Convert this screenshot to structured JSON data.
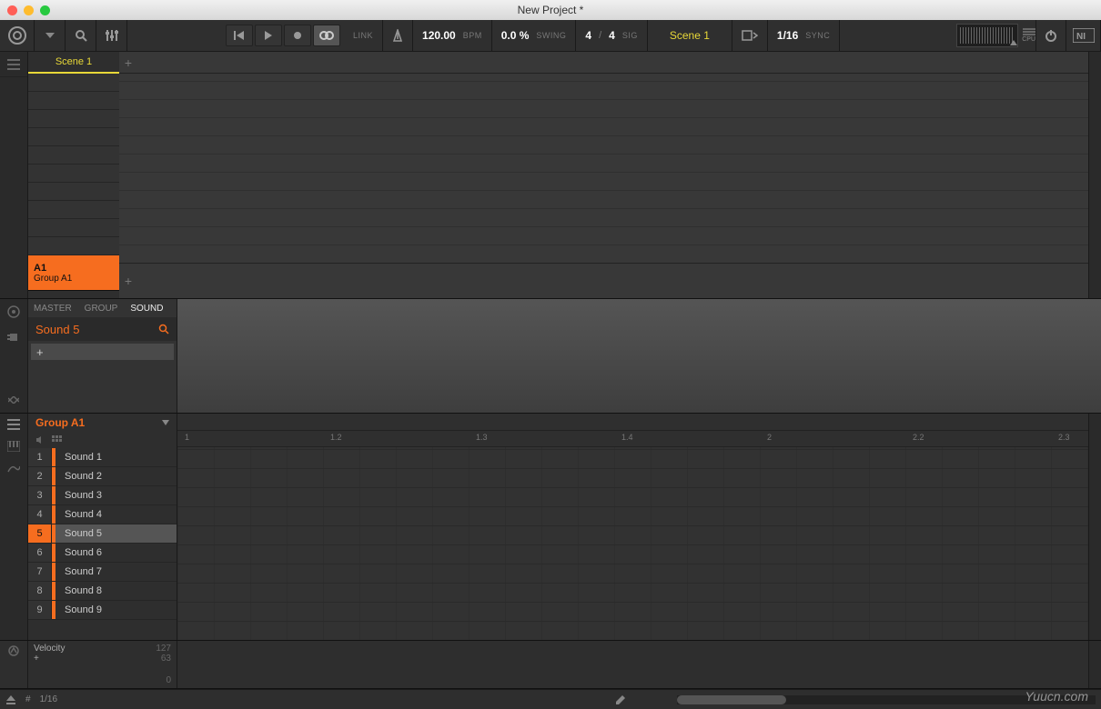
{
  "window": {
    "title": "New Project *"
  },
  "transport": {
    "link": "LINK",
    "tempo": "120.00",
    "tempo_unit": "BPM",
    "swing": "0.0 %",
    "swing_label": "SWING",
    "sig_num": "4",
    "sig_den": "4",
    "sig_label": "SIG",
    "scene": "Scene 1",
    "grid": "1/16",
    "sync": "SYNC",
    "cpu_label": "CPU"
  },
  "arranger": {
    "scene_tab": "Scene 1",
    "group": {
      "id": "A1",
      "name": "Group A1"
    }
  },
  "sound_panel": {
    "tabs": [
      "MASTER",
      "GROUP",
      "SOUND"
    ],
    "active_tab": 2,
    "current_sound": "Sound 5",
    "add_label": "+"
  },
  "pattern": {
    "group_title": "Group A1",
    "ruler": [
      "1",
      "1.2",
      "1.3",
      "1.4",
      "2",
      "2.2",
      "2.3"
    ],
    "ruler_positions": [
      8,
      168,
      328,
      488,
      648,
      808,
      968
    ],
    "sounds": [
      {
        "num": "1",
        "name": "Sound 1"
      },
      {
        "num": "2",
        "name": "Sound 2"
      },
      {
        "num": "3",
        "name": "Sound 3"
      },
      {
        "num": "4",
        "name": "Sound 4"
      },
      {
        "num": "5",
        "name": "Sound 5"
      },
      {
        "num": "6",
        "name": "Sound 6"
      },
      {
        "num": "7",
        "name": "Sound 7"
      },
      {
        "num": "8",
        "name": "Sound 8"
      },
      {
        "num": "9",
        "name": "Sound 9"
      }
    ],
    "selected_sound": 4
  },
  "velocity": {
    "label": "Velocity",
    "add": "+",
    "max": "127",
    "mid": "63",
    "min": "0"
  },
  "footer": {
    "grid": "1/16"
  },
  "watermark": "Yuucn.com",
  "colors": {
    "accent_orange": "#f66d1f",
    "accent_yellow": "#e8d838"
  }
}
